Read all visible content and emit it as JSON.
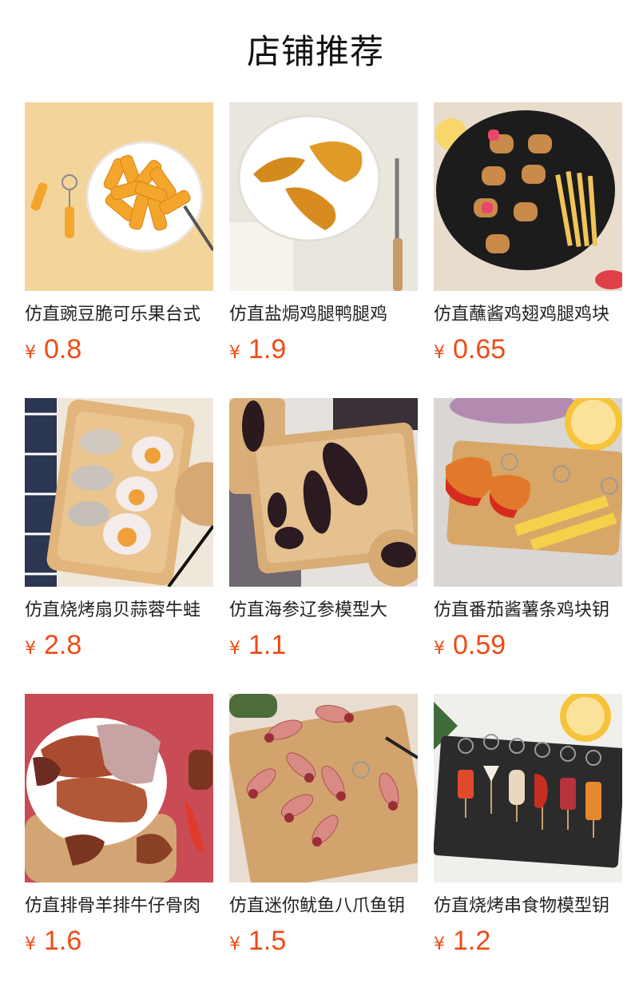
{
  "page": {
    "title": "店铺推荐",
    "accent_color": "#ee4b16"
  },
  "products": [
    {
      "name": "仿直豌豆脆可乐果台式",
      "currency": "¥",
      "price": "0.8",
      "image": "pasta-keychain-photo"
    },
    {
      "name": "仿直盐焗鸡腿鸭腿鸡",
      "currency": "¥",
      "price": "1.9",
      "image": "chicken-leg-plate-photo"
    },
    {
      "name": "仿直蘸酱鸡翅鸡腿鸡块",
      "currency": "¥",
      "price": "0.65",
      "image": "dipped-chicken-fries-photo"
    },
    {
      "name": "仿直烧烤扇贝蒜蓉牛蛙",
      "currency": "¥",
      "price": "2.8",
      "image": "scallop-tray-photo"
    },
    {
      "name": "仿直海参辽参模型大",
      "currency": "¥",
      "price": "1.1",
      "image": "sea-cucumber-tray-photo"
    },
    {
      "name": "仿直番茄酱薯条鸡块钥",
      "currency": "¥",
      "price": "0.59",
      "image": "ketchup-fries-keychain-photo"
    },
    {
      "name": "仿直排骨羊排牛仔骨肉",
      "currency": "¥",
      "price": "1.6",
      "image": "ribs-plate-photo"
    },
    {
      "name": "仿直迷你鱿鱼八爪鱼钥",
      "currency": "¥",
      "price": "1.5",
      "image": "mini-squid-keychain-photo"
    },
    {
      "name": "仿直烧烤串食物模型钥",
      "currency": "¥",
      "price": "1.2",
      "image": "bbq-skewer-keychain-photo"
    }
  ]
}
